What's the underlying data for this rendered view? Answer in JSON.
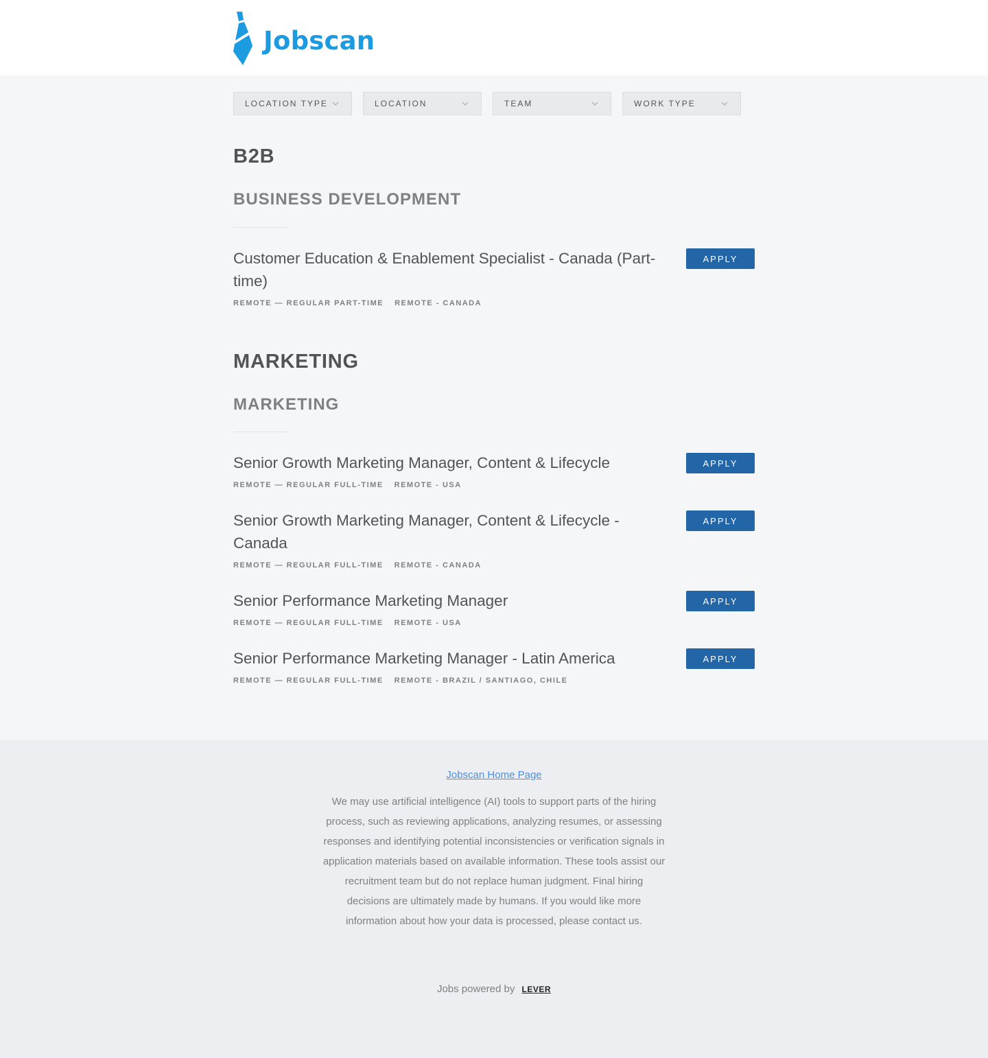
{
  "brand": {
    "name": "Jobscan",
    "color": "#1d9be0"
  },
  "filters": [
    {
      "label": "LOCATION TYPE"
    },
    {
      "label": "LOCATION"
    },
    {
      "label": "TEAM"
    },
    {
      "label": "WORK TYPE"
    }
  ],
  "departments": [
    {
      "name": "B2B",
      "team": "BUSINESS DEVELOPMENT",
      "postings": [
        {
          "title": "Customer Education & Enablement Specialist - Canada (Part-time)",
          "commitment": "REMOTE — REGULAR PART-TIME",
          "location": "REMOTE - CANADA",
          "apply_label": "APPLY"
        }
      ]
    },
    {
      "name": "MARKETING",
      "team": "MARKETING",
      "postings": [
        {
          "title": "Senior Growth Marketing Manager, Content & Lifecycle",
          "commitment": "REMOTE — REGULAR FULL-TIME",
          "location": "REMOTE - USA",
          "apply_label": "APPLY"
        },
        {
          "title": "Senior Growth Marketing Manager, Content & Lifecycle - Canada",
          "commitment": "REMOTE — REGULAR FULL-TIME",
          "location": "REMOTE - CANADA",
          "apply_label": "APPLY"
        },
        {
          "title": "Senior Performance Marketing Manager",
          "commitment": "REMOTE — REGULAR FULL-TIME",
          "location": "REMOTE - USA",
          "apply_label": "APPLY"
        },
        {
          "title": "Senior Performance Marketing Manager - Latin America",
          "commitment": "REMOTE — REGULAR FULL-TIME",
          "location": "REMOTE - BRAZIL / SANTIAGO, CHILE",
          "apply_label": "APPLY"
        }
      ]
    }
  ],
  "footer": {
    "home_link": "Jobscan Home Page",
    "ai_notice": "We may use artificial intelligence (AI) tools to support parts of the hiring process, such as reviewing applications, analyzing resumes, or assessing responses and identifying potential inconsistencies or verification signals in application materials based on available information. These tools assist our recruitment team but do not replace human judgment. Final hiring decisions are ultimately made by humans. If you would like more information about how your data is processed, please contact us.",
    "powered_by": "Jobs powered by",
    "powered_brand": "LEVER"
  },
  "colors": {
    "apply_button": "#2266a8",
    "link": "#4a90e2"
  }
}
